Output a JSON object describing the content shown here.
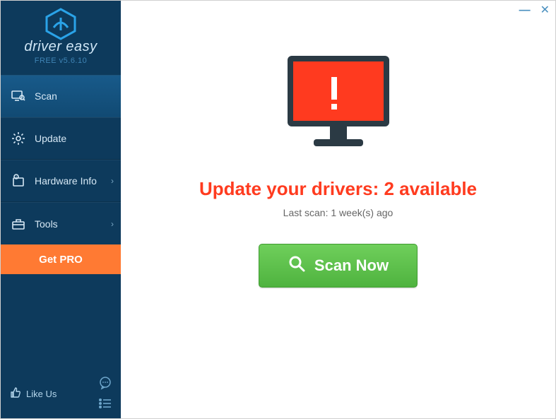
{
  "app": {
    "name": "driver easy",
    "version_label": "FREE v5.6.10"
  },
  "sidebar": {
    "items": [
      {
        "label": "Scan",
        "icon": "monitor-search-icon",
        "active": true,
        "has_sub": false
      },
      {
        "label": "Update",
        "icon": "gear-icon",
        "active": false,
        "has_sub": false
      },
      {
        "label": "Hardware Info",
        "icon": "info-device-icon",
        "active": false,
        "has_sub": true
      },
      {
        "label": "Tools",
        "icon": "toolbox-icon",
        "active": false,
        "has_sub": true
      }
    ],
    "get_pro_label": "Get PRO",
    "like_us_label": "Like Us"
  },
  "main": {
    "headline": "Update your drivers: 2 available",
    "last_scan": "Last scan: 1 week(s) ago",
    "scan_button_label": "Scan Now"
  },
  "colors": {
    "accent_orange": "#ff7a33",
    "alert_red": "#ff3b1f",
    "scan_green": "#4fb33f",
    "sidebar_bg": "#0d3a5c"
  }
}
